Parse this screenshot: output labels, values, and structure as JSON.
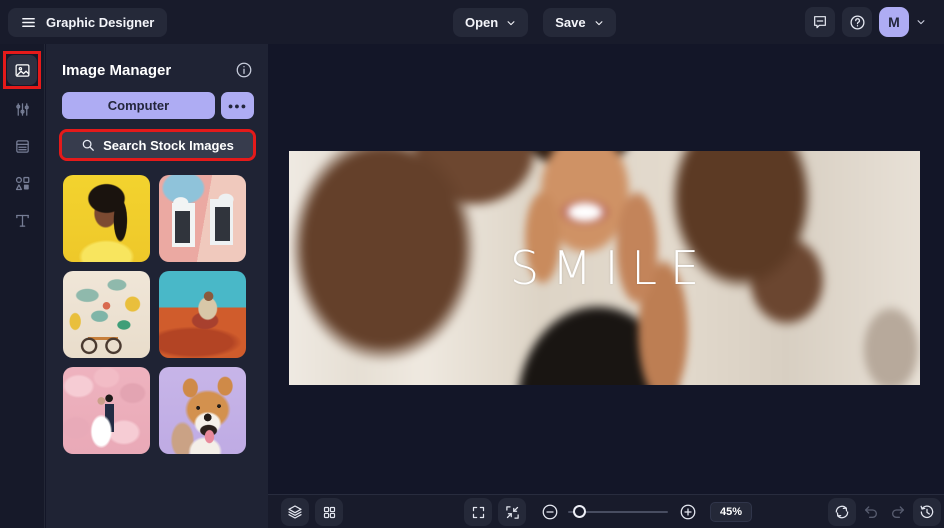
{
  "topbar": {
    "app_title": "Graphic Designer",
    "open_button": "Open",
    "save_button": "Save",
    "avatar_initial": "M"
  },
  "sidebar": {
    "items": [
      {
        "name": "image-manager",
        "active": true
      },
      {
        "name": "edit-settings",
        "active": false
      },
      {
        "name": "templates",
        "active": false
      },
      {
        "name": "graphics-shapes",
        "active": false
      },
      {
        "name": "text-tool",
        "active": false
      }
    ]
  },
  "panel": {
    "title": "Image Manager",
    "computer_button": "Computer",
    "more_button": "●●●",
    "search_label": "Search Stock Images",
    "thumbnails": [
      {
        "label": "Portrait of woman on yellow background"
      },
      {
        "label": "Pastel doors on pink and blue wall"
      },
      {
        "label": "Bicycle against colorful mural wall"
      },
      {
        "label": "Man sitting on orange desert sand"
      },
      {
        "label": "Wedding couple with pink blossoms"
      },
      {
        "label": "Shiba Inu dog on purple background"
      }
    ]
  },
  "canvas": {
    "design_text": "SMILE"
  },
  "bottombar": {
    "zoom_value": "45%"
  },
  "colors": {
    "accent_lavender": "#aeacf3",
    "annotation_red": "#e51a1a",
    "topbar_bg": "#181b2b",
    "panel_bg": "#1f2334",
    "canvas_bg": "#131628"
  }
}
